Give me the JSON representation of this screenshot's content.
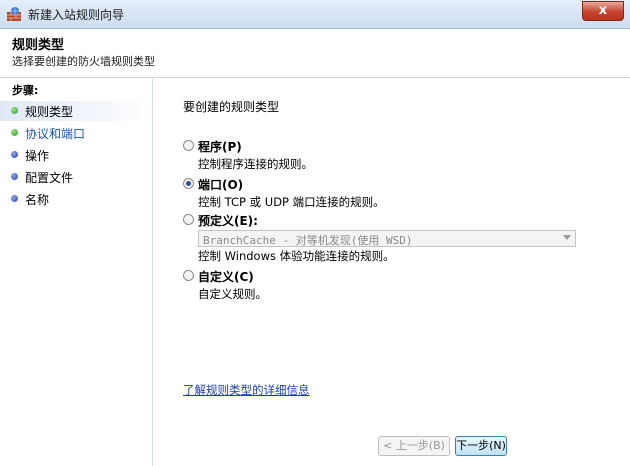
{
  "window": {
    "title": "新建入站规则向导",
    "close_label": "x"
  },
  "header": {
    "title": "规则类型",
    "subtitle": "选择要创建的防火墙规则类型"
  },
  "sidebar": {
    "heading": "步骤:",
    "steps": [
      {
        "label": "规则类型",
        "state": "active",
        "color": "#2e9b1f"
      },
      {
        "label": "协议和端口",
        "state": "current",
        "color": "#2e9b1f"
      },
      {
        "label": "操作",
        "state": "pending",
        "color": "#2b42a6"
      },
      {
        "label": "配置文件",
        "state": "pending",
        "color": "#2b42a6"
      },
      {
        "label": "名称",
        "state": "pending",
        "color": "#2b42a6"
      }
    ]
  },
  "main": {
    "question": "要创建的规则类型",
    "options": [
      {
        "label": "程序(P)",
        "desc": "控制程序连接的规则。",
        "checked": false
      },
      {
        "label": "端口(O)",
        "desc": "控制 TCP 或 UDP 端口连接的规则。",
        "checked": true
      },
      {
        "label": "预定义(E):",
        "select_value": "BranchCache - 对等机发现(使用 WSD)",
        "desc": "控制 Windows 体验功能连接的规则。",
        "checked": false
      },
      {
        "label": "自定义(C)",
        "desc": "自定义规则。",
        "checked": false
      }
    ],
    "learn_more": "了解规则类型的详细信息"
  },
  "buttons": {
    "back": "< 上一步(B)",
    "next": "下一步(N)"
  }
}
